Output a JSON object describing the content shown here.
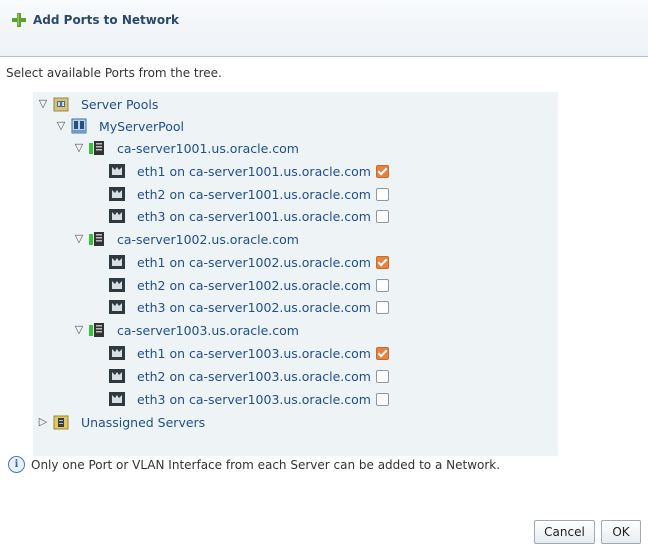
{
  "dialog": {
    "title": "Add Ports to Network",
    "instructions": "Select available Ports from the tree.",
    "info_message": "Only one Port or VLAN Interface from each Server can be added to a Network.",
    "cancel_label": "Cancel",
    "ok_label": "OK"
  },
  "tree": {
    "server_pools": {
      "label": "Server Pools",
      "expanded": true,
      "pool": {
        "label": "MyServerPool",
        "expanded": true,
        "servers": [
          {
            "label": "ca-server1001.us.oracle.com",
            "expanded": true,
            "ports": [
              {
                "label": "eth1 on ca-server1001.us.oracle.com",
                "checked": true
              },
              {
                "label": "eth2 on ca-server1001.us.oracle.com",
                "checked": false
              },
              {
                "label": "eth3 on ca-server1001.us.oracle.com",
                "checked": false
              }
            ]
          },
          {
            "label": "ca-server1002.us.oracle.com",
            "expanded": true,
            "ports": [
              {
                "label": "eth1 on ca-server1002.us.oracle.com",
                "checked": true
              },
              {
                "label": "eth2 on ca-server1002.us.oracle.com",
                "checked": false
              },
              {
                "label": "eth3 on ca-server1002.us.oracle.com",
                "checked": false
              }
            ]
          },
          {
            "label": "ca-server1003.us.oracle.com",
            "expanded": true,
            "ports": [
              {
                "label": "eth1 on ca-server1003.us.oracle.com",
                "checked": true
              },
              {
                "label": "eth2 on ca-server1003.us.oracle.com",
                "checked": false
              },
              {
                "label": "eth3 on ca-server1003.us.oracle.com",
                "checked": false
              }
            ]
          }
        ]
      }
    },
    "unassigned": {
      "label": "Unassigned Servers",
      "expanded": false
    }
  },
  "colors": {
    "link": "#1f4f8f",
    "checked": "#e9823f",
    "tree_bg": "#eef3f6"
  }
}
